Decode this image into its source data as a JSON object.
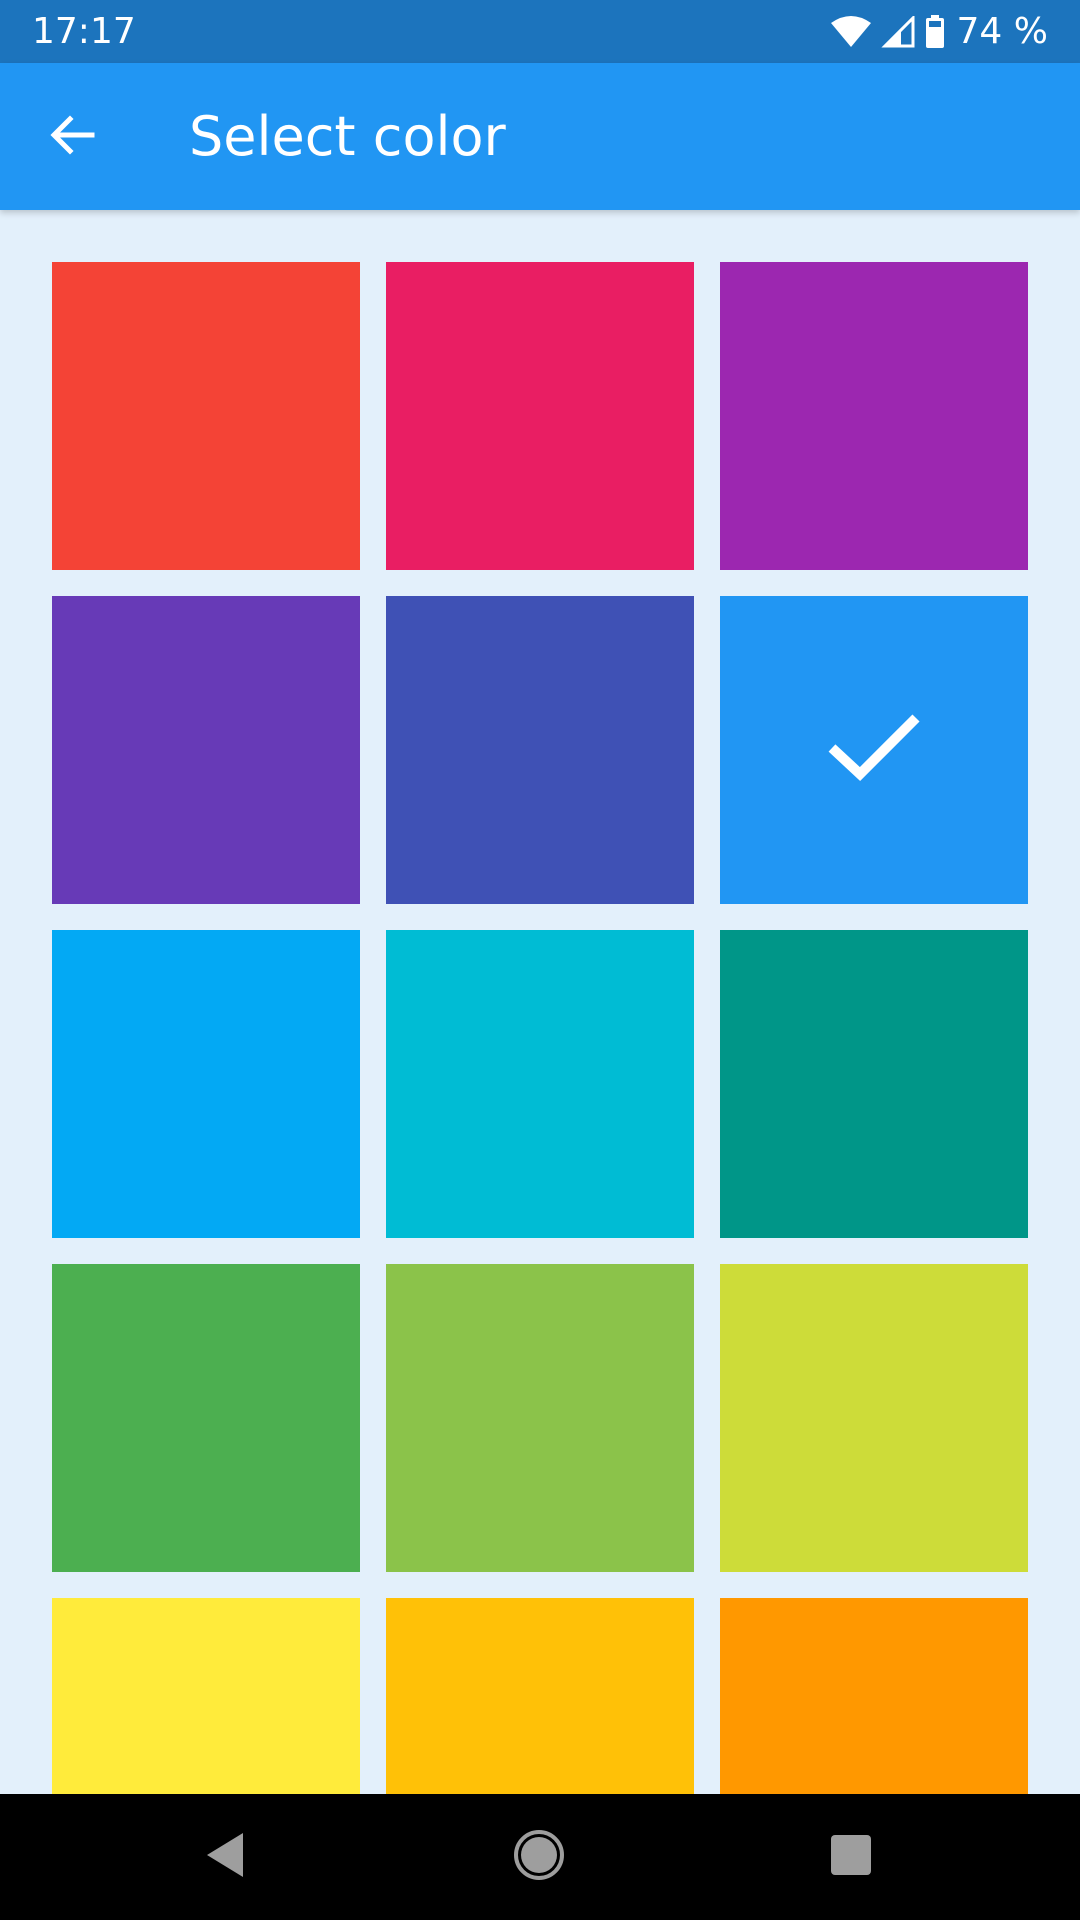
{
  "status_bar": {
    "time": "17:17",
    "battery_percent_label": "74 %",
    "icons": [
      "wifi-icon",
      "signal-icon",
      "battery-icon"
    ]
  },
  "app_bar": {
    "back_icon": "arrow-left-icon",
    "title": "Select color",
    "background": "#2196f3"
  },
  "colors": [
    {
      "name": "red",
      "hex": "#f44336",
      "selected": false
    },
    {
      "name": "pink",
      "hex": "#e91e63",
      "selected": false
    },
    {
      "name": "purple",
      "hex": "#9c27b0",
      "selected": false
    },
    {
      "name": "deep-purple",
      "hex": "#673ab7",
      "selected": false
    },
    {
      "name": "indigo",
      "hex": "#3f51b5",
      "selected": false
    },
    {
      "name": "blue",
      "hex": "#2196f3",
      "selected": true
    },
    {
      "name": "light-blue",
      "hex": "#03a9f4",
      "selected": false
    },
    {
      "name": "cyan",
      "hex": "#00bcd4",
      "selected": false
    },
    {
      "name": "teal",
      "hex": "#009688",
      "selected": false
    },
    {
      "name": "green",
      "hex": "#4caf50",
      "selected": false
    },
    {
      "name": "light-green",
      "hex": "#8bc34a",
      "selected": false
    },
    {
      "name": "lime",
      "hex": "#cddc39",
      "selected": false
    },
    {
      "name": "yellow",
      "hex": "#ffeb3b",
      "selected": false
    },
    {
      "name": "amber",
      "hex": "#ffc107",
      "selected": false
    },
    {
      "name": "orange",
      "hex": "#ff9800",
      "selected": false
    }
  ],
  "nav_bar": {
    "icons": [
      "back-triangle-icon",
      "home-circle-icon",
      "recents-square-icon"
    ]
  }
}
